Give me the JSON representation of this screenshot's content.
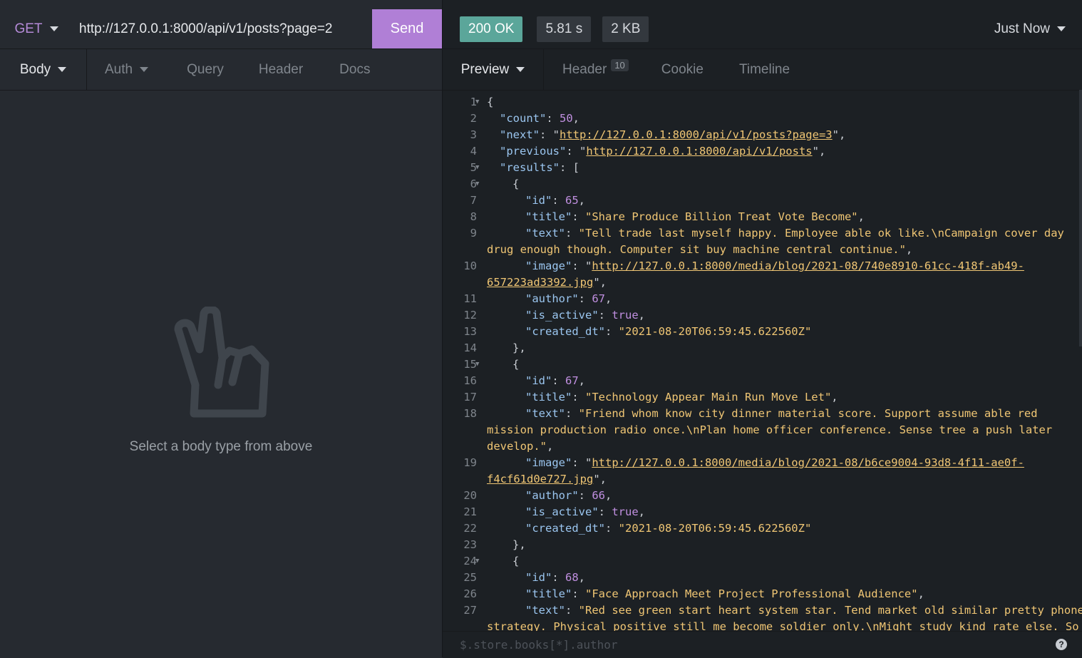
{
  "request": {
    "method": "GET",
    "url": "http://127.0.0.1:8000/api/v1/posts?page=2",
    "send_label": "Send"
  },
  "request_tabs": [
    {
      "label": "Body",
      "active": true
    },
    {
      "label": "Auth"
    },
    {
      "label": "Query"
    },
    {
      "label": "Header"
    },
    {
      "label": "Docs"
    }
  ],
  "empty_state": {
    "icon": "peace-hand-icon",
    "text": "Select a body type from above"
  },
  "response": {
    "status": "200 OK",
    "time": "5.81 s",
    "size": "2 KB",
    "history": "Just Now",
    "status_color": "#5ba69a"
  },
  "response_tabs": [
    {
      "label": "Preview",
      "active": true
    },
    {
      "label": "Header",
      "count": "10"
    },
    {
      "label": "Cookie"
    },
    {
      "label": "Timeline"
    }
  ],
  "filter": {
    "placeholder": "$.store.books[*].author",
    "help": "?"
  },
  "code_lines": [
    {
      "n": "1",
      "fold": true,
      "indent": 0,
      "segs": [
        [
          "p",
          "{"
        ]
      ]
    },
    {
      "n": "2",
      "indent": 1,
      "segs": [
        [
          "k",
          "\"count\""
        ],
        [
          "p",
          ": "
        ],
        [
          "n",
          "50"
        ],
        [
          "p",
          ","
        ]
      ]
    },
    {
      "n": "3",
      "indent": 1,
      "segs": [
        [
          "k",
          "\"next\""
        ],
        [
          "p",
          ": \""
        ],
        [
          "u",
          "http://127.0.0.1:8000/api/v1/posts?page=3"
        ],
        [
          "p",
          "\","
        ]
      ]
    },
    {
      "n": "4",
      "indent": 1,
      "segs": [
        [
          "k",
          "\"previous\""
        ],
        [
          "p",
          ": \""
        ],
        [
          "u",
          "http://127.0.0.1:8000/api/v1/posts"
        ],
        [
          "p",
          "\","
        ]
      ]
    },
    {
      "n": "5",
      "fold": true,
      "indent": 1,
      "segs": [
        [
          "k",
          "\"results\""
        ],
        [
          "p",
          ": ["
        ]
      ]
    },
    {
      "n": "6",
      "fold": true,
      "indent": 2,
      "segs": [
        [
          "p",
          "{"
        ]
      ]
    },
    {
      "n": "7",
      "indent": 3,
      "segs": [
        [
          "k",
          "\"id\""
        ],
        [
          "p",
          ": "
        ],
        [
          "n",
          "65"
        ],
        [
          "p",
          ","
        ]
      ]
    },
    {
      "n": "8",
      "indent": 3,
      "segs": [
        [
          "k",
          "\"title\""
        ],
        [
          "p",
          ": "
        ],
        [
          "s",
          "\"Share Produce Billion Treat Vote Become\""
        ],
        [
          "p",
          ","
        ]
      ]
    },
    {
      "n": "9",
      "indent": 3,
      "segs": [
        [
          "k",
          "\"text\""
        ],
        [
          "p",
          ": "
        ],
        [
          "s",
          "\"Tell trade last myself happy. Employee able ok like.\\nCampaign cover day"
        ]
      ]
    },
    {
      "n": "",
      "indent": 0,
      "segs": [
        [
          "s",
          "drug enough though. Computer sit buy machine central continue.\""
        ],
        [
          "p",
          ","
        ]
      ]
    },
    {
      "n": "10",
      "indent": 3,
      "segs": [
        [
          "k",
          "\"image\""
        ],
        [
          "p",
          ": \""
        ],
        [
          "u",
          "http://127.0.0.1:8000/media/blog/2021-08/740e8910-61cc-418f-ab49-"
        ]
      ]
    },
    {
      "n": "",
      "indent": 0,
      "segs": [
        [
          "u",
          "657223ad3392.jpg"
        ],
        [
          "p",
          "\","
        ]
      ]
    },
    {
      "n": "11",
      "indent": 3,
      "segs": [
        [
          "k",
          "\"author\""
        ],
        [
          "p",
          ": "
        ],
        [
          "n",
          "67"
        ],
        [
          "p",
          ","
        ]
      ]
    },
    {
      "n": "12",
      "indent": 3,
      "segs": [
        [
          "k",
          "\"is_active\""
        ],
        [
          "p",
          ": "
        ],
        [
          "b",
          "true"
        ],
        [
          "p",
          ","
        ]
      ]
    },
    {
      "n": "13",
      "indent": 3,
      "segs": [
        [
          "k",
          "\"created_dt\""
        ],
        [
          "p",
          ": "
        ],
        [
          "s",
          "\"2021-08-20T06:59:45.622560Z\""
        ]
      ]
    },
    {
      "n": "14",
      "indent": 2,
      "segs": [
        [
          "p",
          "},"
        ]
      ]
    },
    {
      "n": "15",
      "fold": true,
      "indent": 2,
      "segs": [
        [
          "p",
          "{"
        ]
      ]
    },
    {
      "n": "16",
      "indent": 3,
      "segs": [
        [
          "k",
          "\"id\""
        ],
        [
          "p",
          ": "
        ],
        [
          "n",
          "67"
        ],
        [
          "p",
          ","
        ]
      ]
    },
    {
      "n": "17",
      "indent": 3,
      "segs": [
        [
          "k",
          "\"title\""
        ],
        [
          "p",
          ": "
        ],
        [
          "s",
          "\"Technology Appear Main Run Move Let\""
        ],
        [
          "p",
          ","
        ]
      ]
    },
    {
      "n": "18",
      "indent": 3,
      "segs": [
        [
          "k",
          "\"text\""
        ],
        [
          "p",
          ": "
        ],
        [
          "s",
          "\"Friend whom know city dinner material score. Support assume able red"
        ]
      ]
    },
    {
      "n": "",
      "indent": 0,
      "segs": [
        [
          "s",
          "mission production radio once.\\nPlan home officer conference. Sense tree a push later"
        ]
      ]
    },
    {
      "n": "",
      "indent": 0,
      "segs": [
        [
          "s",
          "develop.\""
        ],
        [
          "p",
          ","
        ]
      ]
    },
    {
      "n": "19",
      "indent": 3,
      "segs": [
        [
          "k",
          "\"image\""
        ],
        [
          "p",
          ": \""
        ],
        [
          "u",
          "http://127.0.0.1:8000/media/blog/2021-08/b6ce9004-93d8-4f11-ae0f-"
        ]
      ]
    },
    {
      "n": "",
      "indent": 0,
      "segs": [
        [
          "u",
          "f4cf61d0e727.jpg"
        ],
        [
          "p",
          "\","
        ]
      ]
    },
    {
      "n": "20",
      "indent": 3,
      "segs": [
        [
          "k",
          "\"author\""
        ],
        [
          "p",
          ": "
        ],
        [
          "n",
          "66"
        ],
        [
          "p",
          ","
        ]
      ]
    },
    {
      "n": "21",
      "indent": 3,
      "segs": [
        [
          "k",
          "\"is_active\""
        ],
        [
          "p",
          ": "
        ],
        [
          "b",
          "true"
        ],
        [
          "p",
          ","
        ]
      ]
    },
    {
      "n": "22",
      "indent": 3,
      "segs": [
        [
          "k",
          "\"created_dt\""
        ],
        [
          "p",
          ": "
        ],
        [
          "s",
          "\"2021-08-20T06:59:45.622560Z\""
        ]
      ]
    },
    {
      "n": "23",
      "indent": 2,
      "segs": [
        [
          "p",
          "},"
        ]
      ]
    },
    {
      "n": "24",
      "fold": true,
      "indent": 2,
      "segs": [
        [
          "p",
          "{"
        ]
      ]
    },
    {
      "n": "25",
      "indent": 3,
      "segs": [
        [
          "k",
          "\"id\""
        ],
        [
          "p",
          ": "
        ],
        [
          "n",
          "68"
        ],
        [
          "p",
          ","
        ]
      ]
    },
    {
      "n": "26",
      "indent": 3,
      "segs": [
        [
          "k",
          "\"title\""
        ],
        [
          "p",
          ": "
        ],
        [
          "s",
          "\"Face Approach Meet Project Professional Audience\""
        ],
        [
          "p",
          ","
        ]
      ]
    },
    {
      "n": "27",
      "indent": 3,
      "segs": [
        [
          "k",
          "\"text\""
        ],
        [
          "p",
          ": "
        ],
        [
          "s",
          "\"Red see green start heart system star. Tend market old similar pretty phone"
        ]
      ]
    },
    {
      "n": "",
      "indent": 0,
      "segs": [
        [
          "s",
          "strategy. Physical positive still me become soldier only.\\nMight study kind rate else. So"
        ]
      ]
    }
  ]
}
